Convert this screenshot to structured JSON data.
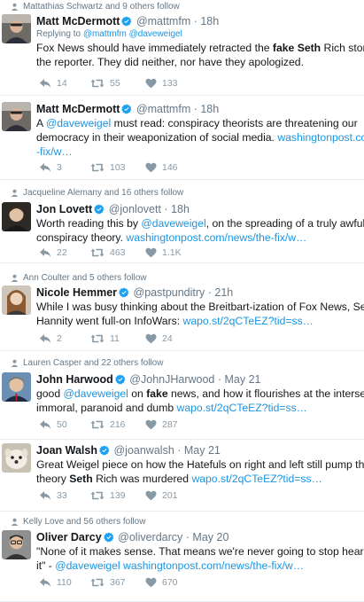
{
  "tweets": [
    {
      "context": "Mattathias Schwartz and 9 others follow",
      "name": "Matt McDermott",
      "handle": "@mattmfm",
      "time": "18h",
      "reply_prefix": "Replying to",
      "reply_handles": "@mattmfm @daveweigel",
      "lines": [
        [
          {
            "t": "Fox News should have immediately retracted the "
          },
          {
            "t": "fake",
            "b": true
          },
          {
            "t": " "
          },
          {
            "t": "Seth",
            "b": true
          },
          {
            "t": " Rich story and fired"
          }
        ],
        [
          {
            "t": "the reporter. They did neither, nor have they apologized."
          }
        ]
      ],
      "replies": "14",
      "retweets": "55",
      "likes": "133"
    },
    {
      "name": "Matt McDermott",
      "handle": "@mattmfm",
      "time": "18h",
      "lines": [
        [
          {
            "t": "A "
          },
          {
            "t": "@daveweigel",
            "l": true
          },
          {
            "t": " must read: conspiracy theorists are threatening our"
          }
        ],
        [
          {
            "t": "democracy in their weaponization of social media. "
          },
          {
            "t": "washingtonpost.com/news/the",
            "l": true
          }
        ],
        [
          {
            "t": "-fix/w…",
            "l": true
          }
        ]
      ],
      "replies": "3",
      "retweets": "103",
      "likes": "146"
    },
    {
      "context": "Jacqueline Alemany and 16 others follow",
      "name": "Jon Lovett",
      "handle": "@jonlovett",
      "time": "18h",
      "lines": [
        [
          {
            "t": "Worth reading this by "
          },
          {
            "t": "@daveweigel",
            "l": true
          },
          {
            "t": ", on the spreading of a truly awful"
          }
        ],
        [
          {
            "t": "conspiracy theory. "
          },
          {
            "t": "washingtonpost.com/news/the-fix/w…",
            "l": true
          }
        ]
      ],
      "replies": "22",
      "retweets": "463",
      "likes": "1.1K"
    },
    {
      "context": "Ann Coulter and 5 others follow",
      "name": "Nicole Hemmer",
      "handle": "@pastpunditry",
      "time": "21h",
      "lines": [
        [
          {
            "t": "While I was busy thinking about the Breitbart-ization of Fox News, Sean"
          }
        ],
        [
          {
            "t": "Hannity went full-on InfoWars: "
          },
          {
            "t": "wapo.st/2qCTeEZ?tid=ss…",
            "l": true
          }
        ]
      ],
      "replies": "2",
      "retweets": "11",
      "likes": "24"
    },
    {
      "context": "Lauren Casper and 22 others follow",
      "name": "John Harwood",
      "handle": "@JohnJHarwood",
      "time": "May 21",
      "lines": [
        [
          {
            "t": "good "
          },
          {
            "t": "@daveweigel",
            "l": true
          },
          {
            "t": " on "
          },
          {
            "t": "fake",
            "b": true
          },
          {
            "t": " news, and how it flourishes at the intersection of"
          }
        ],
        [
          {
            "t": "immoral, paranoid and dumb "
          },
          {
            "t": "wapo.st/2qCTeEZ?tid=ss…",
            "l": true
          }
        ]
      ],
      "replies": "50",
      "retweets": "216",
      "likes": "287"
    },
    {
      "name": "Joan Walsh",
      "handle": "@joanwalsh",
      "time": "May 21",
      "lines": [
        [
          {
            "t": "Great Weigel piece on how the Hatefuls on right and left still pump the cruel"
          }
        ],
        [
          {
            "t": "theory "
          },
          {
            "t": "Seth",
            "b": true
          },
          {
            "t": " Rich was murdered "
          },
          {
            "t": "wapo.st/2qCTeEZ?tid=ss…",
            "l": true
          }
        ]
      ],
      "replies": "33",
      "retweets": "139",
      "likes": "201"
    },
    {
      "context": "Kelly Love and 56 others follow",
      "name": "Oliver Darcy",
      "handle": "@oliverdarcy",
      "time": "May 20",
      "lines": [
        [
          {
            "t": "\"None of it makes sense. That means we're never going to stop hearing about"
          }
        ],
        [
          {
            "t": "it\" - "
          },
          {
            "t": "@daveweigel",
            "l": true
          },
          {
            "t": " "
          },
          {
            "t": "washingtonpost.com/news/the-fix/w…",
            "l": true
          }
        ]
      ],
      "replies": "110",
      "retweets": "367",
      "likes": "670"
    }
  ],
  "colors": {
    "link": "#1b95e0",
    "verified": "#1da1f2",
    "meta": "#657786",
    "action": "#8899a6",
    "divider": "#e6ecf0"
  },
  "icons": {
    "context": "follow-context-icon",
    "verified": "verified-badge-icon",
    "reply": "reply-icon",
    "retweet": "retweet-icon",
    "like": "like-icon"
  }
}
